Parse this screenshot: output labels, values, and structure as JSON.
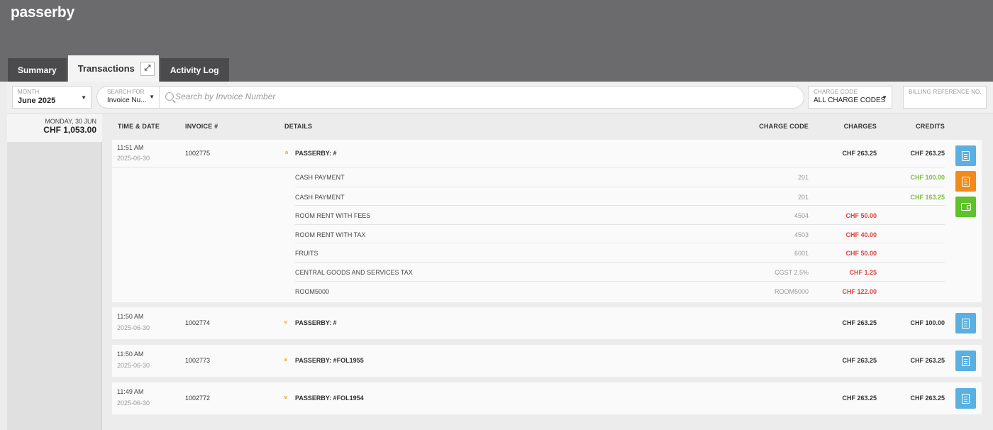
{
  "app": {
    "title": "passerby"
  },
  "tabs": [
    {
      "label": "Summary"
    },
    {
      "label": "Transactions"
    },
    {
      "label": "Activity Log"
    }
  ],
  "filters": {
    "month": {
      "label": "MONTH",
      "value": "June 2025"
    },
    "search_for": {
      "label": "SEARCH FOR",
      "value": "Invoice Nu..."
    },
    "search": {
      "placeholder": "Search by Invoice Number"
    },
    "charge_code": {
      "label": "CHARGE CODE",
      "value": "ALL CHARGE CODES"
    },
    "billing_ref": {
      "label": "BILLING REFERENCE NO.",
      "value": ""
    }
  },
  "day": {
    "date": "MONDAY, 30 JUN",
    "total": "CHF 1,053.00"
  },
  "columns": {
    "time_date": "TIME & DATE",
    "invoice": "INVOICE #",
    "details": "DETAILS",
    "charge_code": "CHARGE CODE",
    "charges": "CHARGES",
    "credits": "CREDITS"
  },
  "transactions": [
    {
      "time": "11:51 AM",
      "date": "2025-06-30",
      "invoice": "1002775",
      "expanded": true,
      "chevron": "»",
      "detail": "PASSERBY: #",
      "charges": "CHF 263.25",
      "credits": "CHF 263.25",
      "items": [
        {
          "name": "CASH PAYMENT",
          "code": "201",
          "charge": "",
          "credit": "CHF 100.00"
        },
        {
          "name": "CASH PAYMENT",
          "code": "201",
          "charge": "",
          "credit": "CHF 163.25"
        },
        {
          "name": "ROOM RENT WITH FEES",
          "code": "4504",
          "charge": "CHF 50.00",
          "credit": ""
        },
        {
          "name": "ROOM RENT WITH TAX",
          "code": "4503",
          "charge": "CHF 40.00",
          "credit": ""
        },
        {
          "name": "FRUITS",
          "code": "6001",
          "charge": "CHF 50.00",
          "credit": ""
        },
        {
          "name": "CENTRAL GOODS AND SERVICES TAX",
          "code": "CGST 2.5%",
          "charge": "CHF 1.25",
          "credit": ""
        },
        {
          "name": "ROOM5000",
          "code": "ROOM5000",
          "charge": "CHF 122.00",
          "credit": ""
        }
      ]
    },
    {
      "time": "11:50 AM",
      "date": "2025-06-30",
      "invoice": "1002774",
      "expanded": false,
      "chevron": "»",
      "detail": "PASSERBY: #",
      "charges": "CHF 263.25",
      "credits": "CHF 100.00"
    },
    {
      "time": "11:50 AM",
      "date": "2025-06-30",
      "invoice": "1002773",
      "expanded": false,
      "chevron": "»",
      "detail": "PASSERBY: #FOL1955",
      "charges": "CHF 263.25",
      "credits": "CHF 263.25"
    },
    {
      "time": "11:49 AM",
      "date": "2025-06-30",
      "invoice": "1002772",
      "expanded": false,
      "chevron": "»",
      "detail": "PASSERBY: #FOL1954",
      "charges": "CHF 263.25",
      "credits": "CHF 263.25"
    }
  ],
  "icons": {
    "popout": "popout-icon",
    "search": "search-icon",
    "invoice": "invoice-icon",
    "receipt": "receipt-icon",
    "wallet": "wallet-icon"
  },
  "colors": {
    "header_bg": "#6b6b6d",
    "charge_red": "#e0403a",
    "credit_green": "#7bbf3a",
    "chevron_orange": "#e8a21c",
    "btn_blue": "#5ab0e0",
    "btn_orange": "#f08a1c",
    "btn_green": "#5ec22a"
  }
}
